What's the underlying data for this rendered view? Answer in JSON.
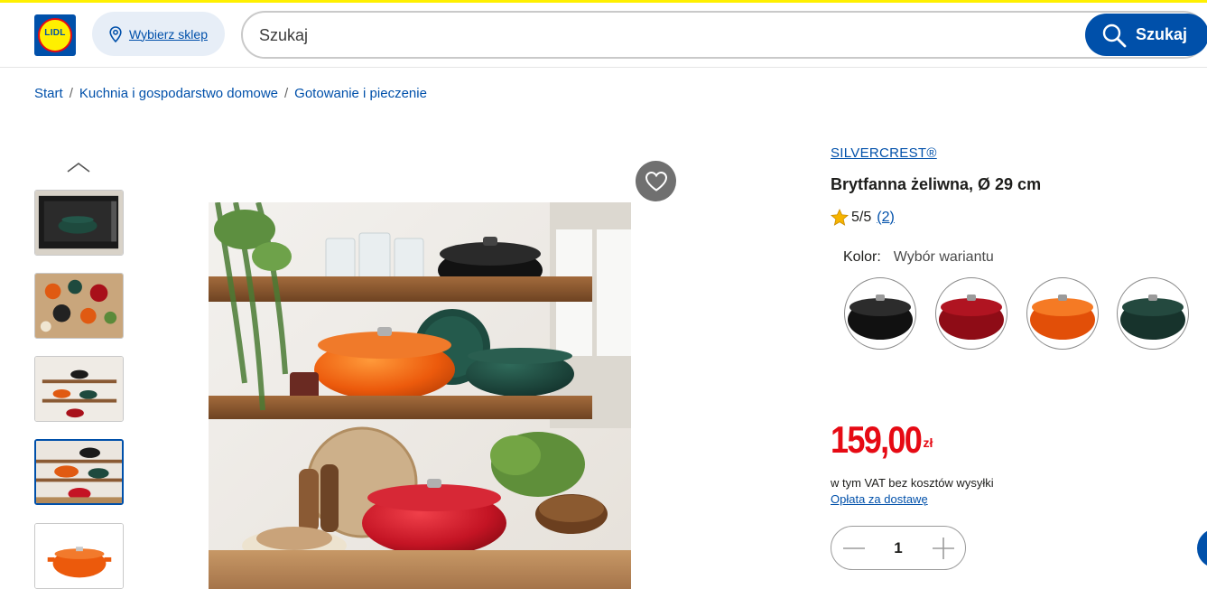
{
  "colors": {
    "brand_blue": "#0050aa",
    "price_red": "#e60a14",
    "logo_yellow": "#fff000",
    "accent_top": "#fff000"
  },
  "header": {
    "logo_text": "LIDL",
    "store_button_label": "Wybierz sklep",
    "search_placeholder": "Szukaj",
    "search_button_label": "Szukaj"
  },
  "breadcrumb": {
    "items": [
      {
        "label": "Start"
      },
      {
        "label": "Kuchnia i gospodarstwo domowe"
      },
      {
        "label": "Gotowanie i pieczenie"
      }
    ],
    "separator": "/"
  },
  "gallery": {
    "thumbnails": [
      {
        "name": "thumb-oven",
        "active": false
      },
      {
        "name": "thumb-table-spread",
        "active": false
      },
      {
        "name": "thumb-shelf-wide",
        "active": false
      },
      {
        "name": "thumb-shelf-closeup",
        "active": true
      },
      {
        "name": "thumb-orange-pot",
        "active": false
      }
    ],
    "favorite_icon": "heart-icon",
    "prev_icon": "chevron-up-icon"
  },
  "product": {
    "brand": "SILVERCREST®",
    "title": "Brytfanna żeliwna, Ø 29 cm",
    "rating": "5/5",
    "rating_count": "(2)",
    "color_label": "Kolor:",
    "color_value": "Wybór wariantu",
    "variants": [
      {
        "name": "black",
        "color": "#1a1a1a"
      },
      {
        "name": "red",
        "color": "#a8101a"
      },
      {
        "name": "orange",
        "color": "#ec5a0c"
      },
      {
        "name": "green",
        "color": "#1d3b33"
      }
    ],
    "price": "159,00",
    "currency": "zł",
    "vat_note": "w tym VAT bez kosztów wysyłki",
    "shipping_link": "Opłata za dostawę",
    "quantity": "1"
  }
}
